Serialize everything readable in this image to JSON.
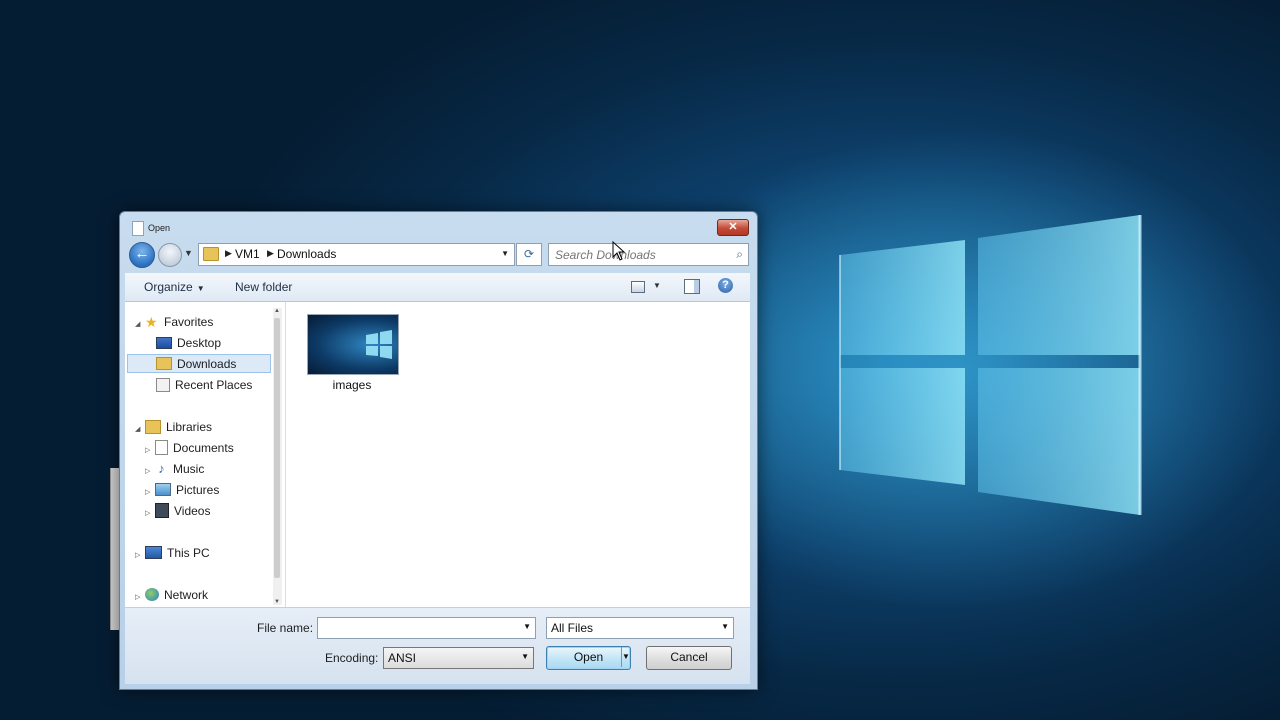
{
  "dialog": {
    "title": "Open",
    "close_glyph": "✕"
  },
  "nav": {
    "back_glyph": "←",
    "breadcrumb": [
      "VM1",
      "Downloads"
    ],
    "refresh_glyph": "⟳",
    "search_placeholder": "Search Downloads"
  },
  "toolbar": {
    "organize_label": "Organize",
    "new_folder_label": "New folder",
    "help_glyph": "?"
  },
  "sidebar": {
    "favorites": {
      "label": "Favorites",
      "items": [
        "Desktop",
        "Downloads",
        "Recent Places"
      ],
      "selected": "Downloads"
    },
    "libraries": {
      "label": "Libraries",
      "items": [
        "Documents",
        "Music",
        "Pictures",
        "Videos"
      ]
    },
    "this_pc": "This PC",
    "network": "Network"
  },
  "files": [
    {
      "name": "images",
      "type": "folder-with-preview"
    }
  ],
  "footer": {
    "file_name_label": "File name:",
    "file_name_value": "",
    "file_type_value": "All Files",
    "encoding_label": "Encoding:",
    "encoding_value": "ANSI",
    "open_label": "Open",
    "cancel_label": "Cancel"
  },
  "colors": {
    "desktop_bg": "#0a2f52",
    "dialog_frame": "#c8dcef",
    "selection": "#dceaf8",
    "close_button": "#c44a35"
  }
}
